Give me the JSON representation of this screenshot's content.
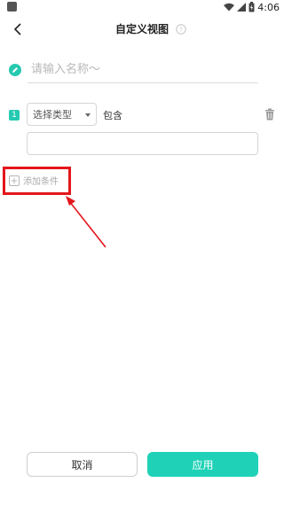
{
  "status_bar": {
    "time": "4:06"
  },
  "header": {
    "title": "自定义视图",
    "back_icon": "chevron-left-icon",
    "help_icon": "help-circle-icon"
  },
  "name_field": {
    "placeholder": "请输入名称～",
    "value": ""
  },
  "condition": {
    "index": "1",
    "type_select": "选择类型",
    "operator": "包含",
    "value": ""
  },
  "add_condition": {
    "label": "添加条件"
  },
  "footer": {
    "cancel_label": "取消",
    "apply_label": "应用"
  },
  "colors": {
    "accent": "#1fd2b7",
    "annotation": "#e3161b"
  }
}
